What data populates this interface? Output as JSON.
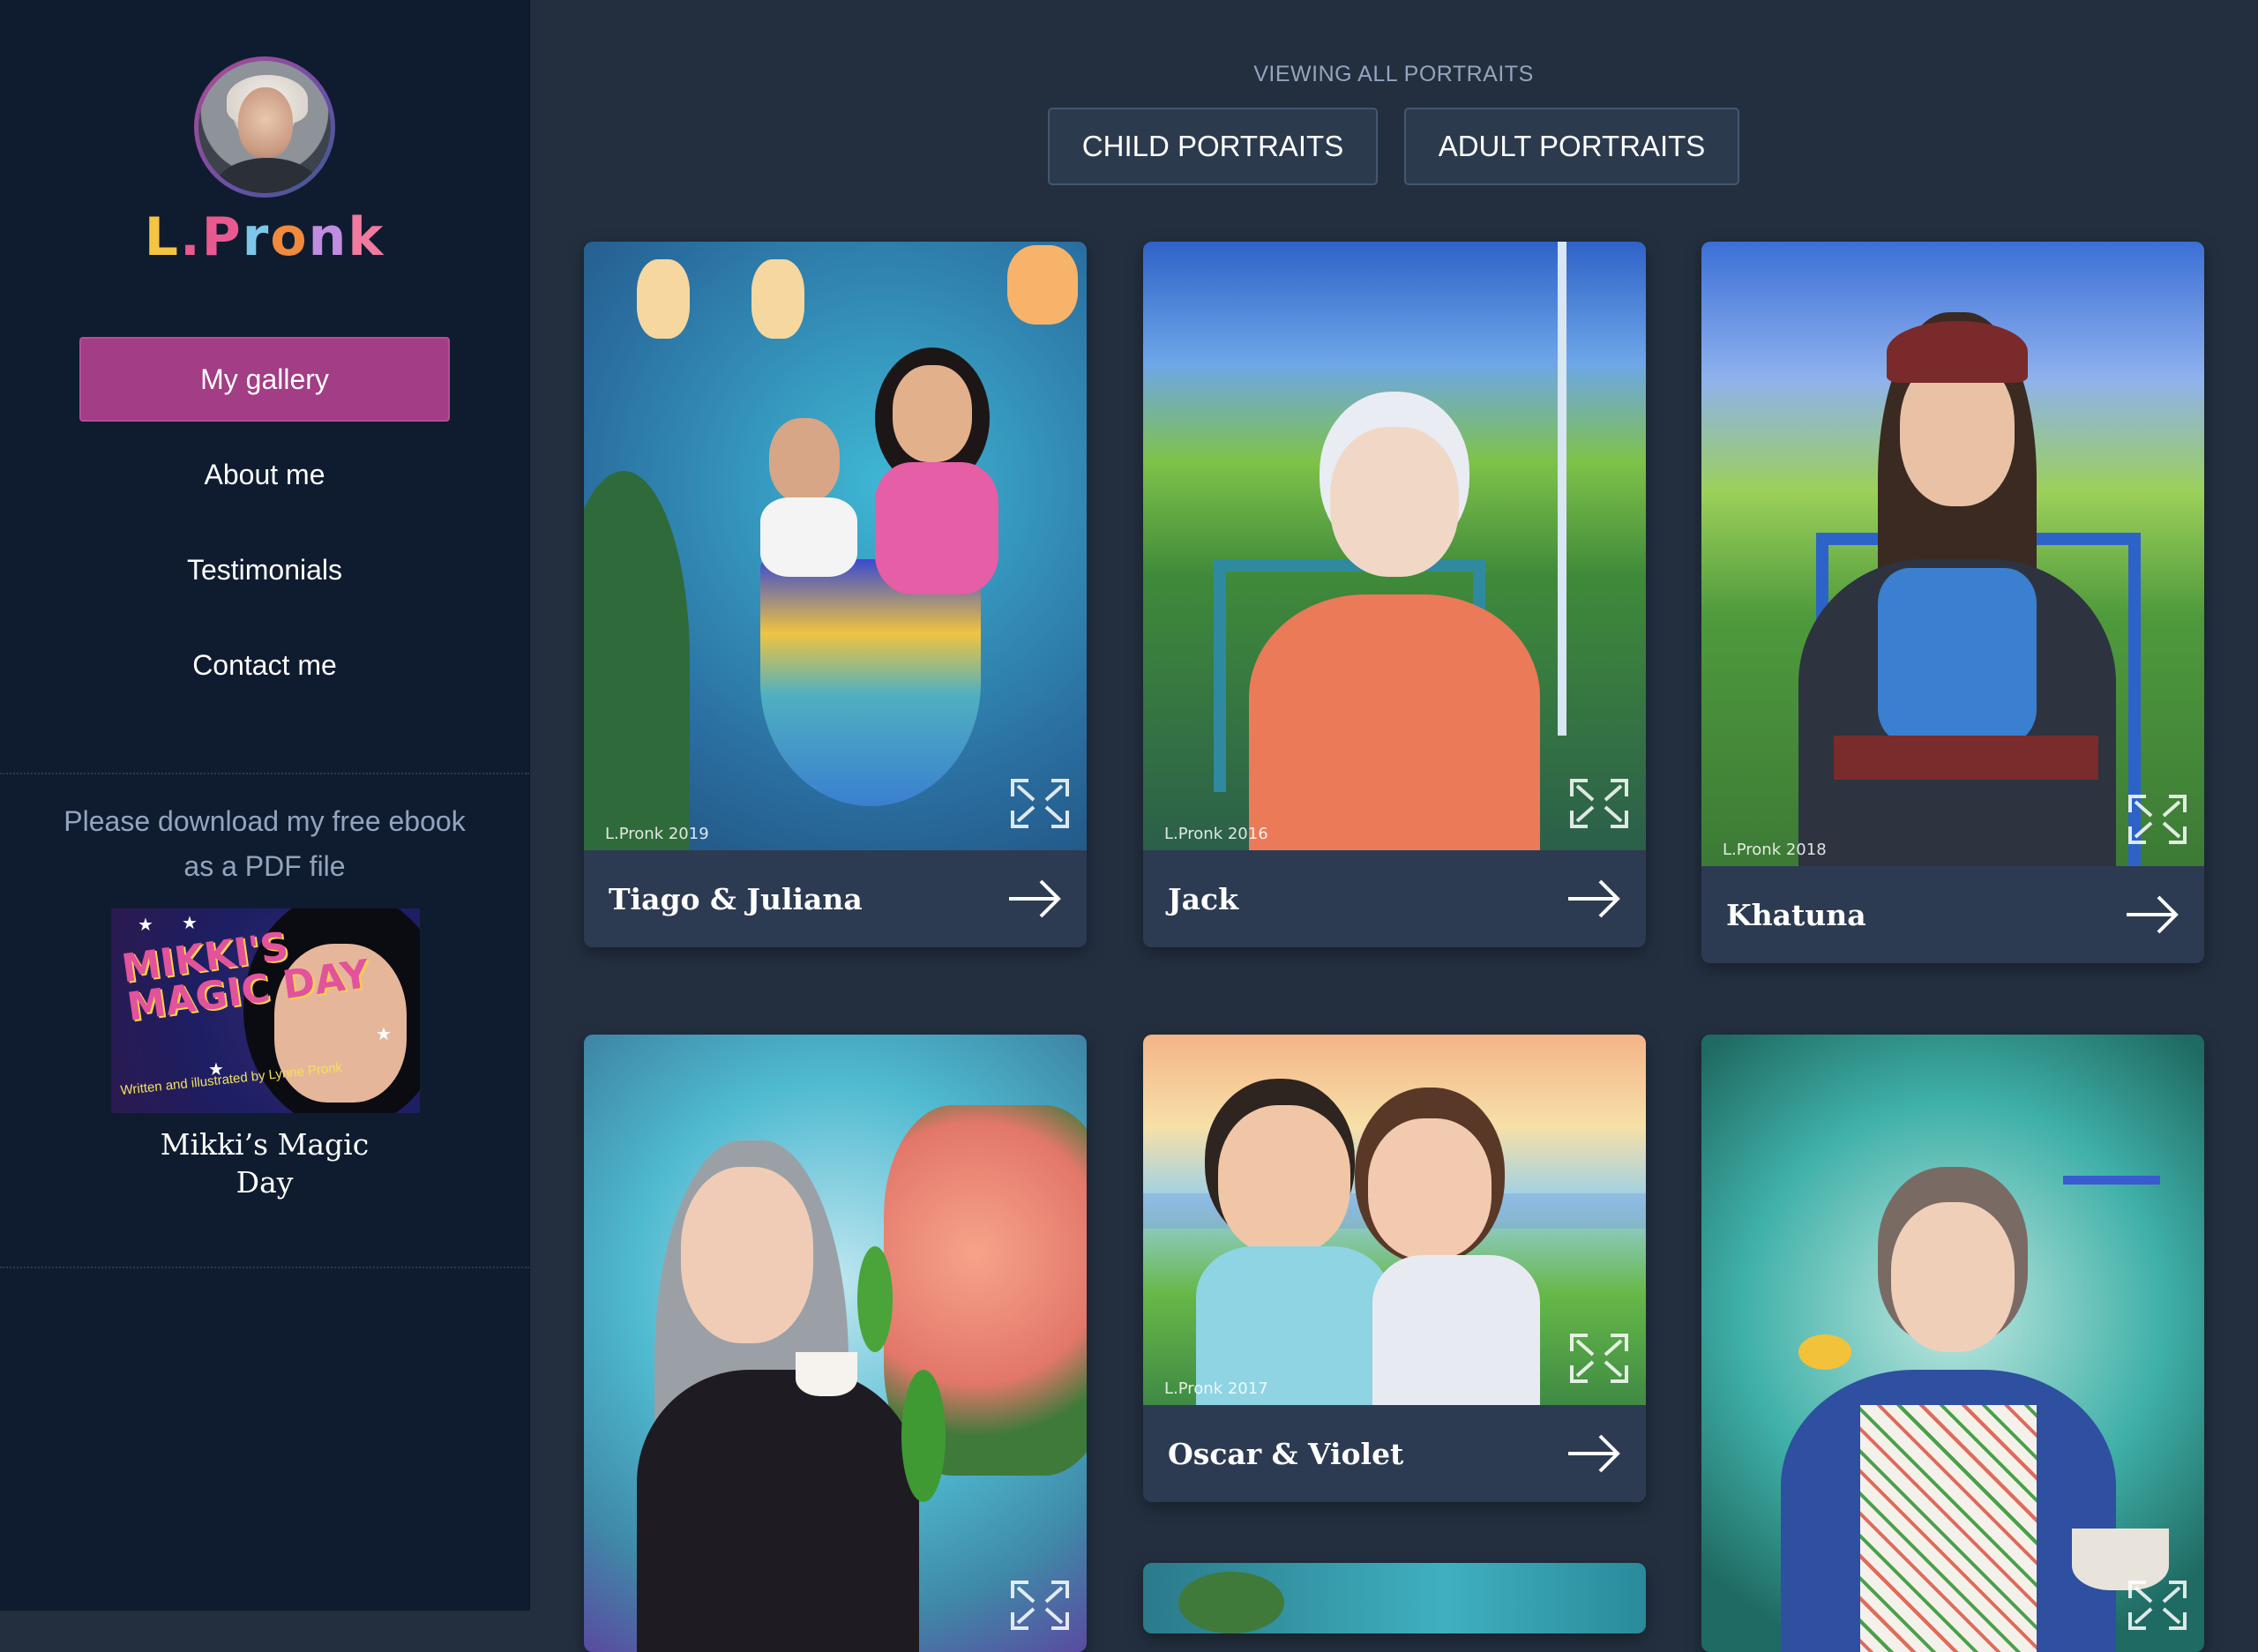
{
  "sidebar": {
    "logo_text": "L.Pronk",
    "logo_letters": [
      "L",
      ".",
      "P",
      "r",
      "o",
      "n",
      "k"
    ],
    "nav": [
      {
        "label": "My gallery",
        "active": true
      },
      {
        "label": "About me"
      },
      {
        "label": "Testimonials"
      },
      {
        "label": "Contact me"
      }
    ],
    "ebook_prompt": "Please download my free ebook as a PDF file",
    "ebook_cover_title": "MIKKI'S MAGIC DAY",
    "ebook_cover_credit": "Written and illustrated by Lynne Pronk",
    "ebook_name": "Mikki’s Magic Day"
  },
  "main": {
    "viewing_label": "VIEWING ALL PORTRAITS",
    "filters": [
      "CHILD PORTRAITS",
      "ADULT PORTRAITS"
    ],
    "cards": [
      {
        "title": "Tiago & Juliana",
        "signature": "L.Pronk 2019"
      },
      {
        "title": "Jack",
        "signature": "L.Pronk 2016"
      },
      {
        "title": "Khatuna",
        "signature": "L.Pronk 2018"
      },
      {
        "title": ""
      },
      {
        "title": "Oscar & Violet",
        "signature": "L.Pronk 2017"
      },
      {
        "title": ""
      },
      {
        "title": ""
      }
    ]
  },
  "colors": {
    "sidebar_bg": "#0f1c2f",
    "main_bg": "#232f3f",
    "accent": "#a23d86",
    "card_bg": "#2d3b52",
    "muted_text": "#93a4be"
  },
  "icons": [
    "arrow-right-icon",
    "expand-icon"
  ]
}
